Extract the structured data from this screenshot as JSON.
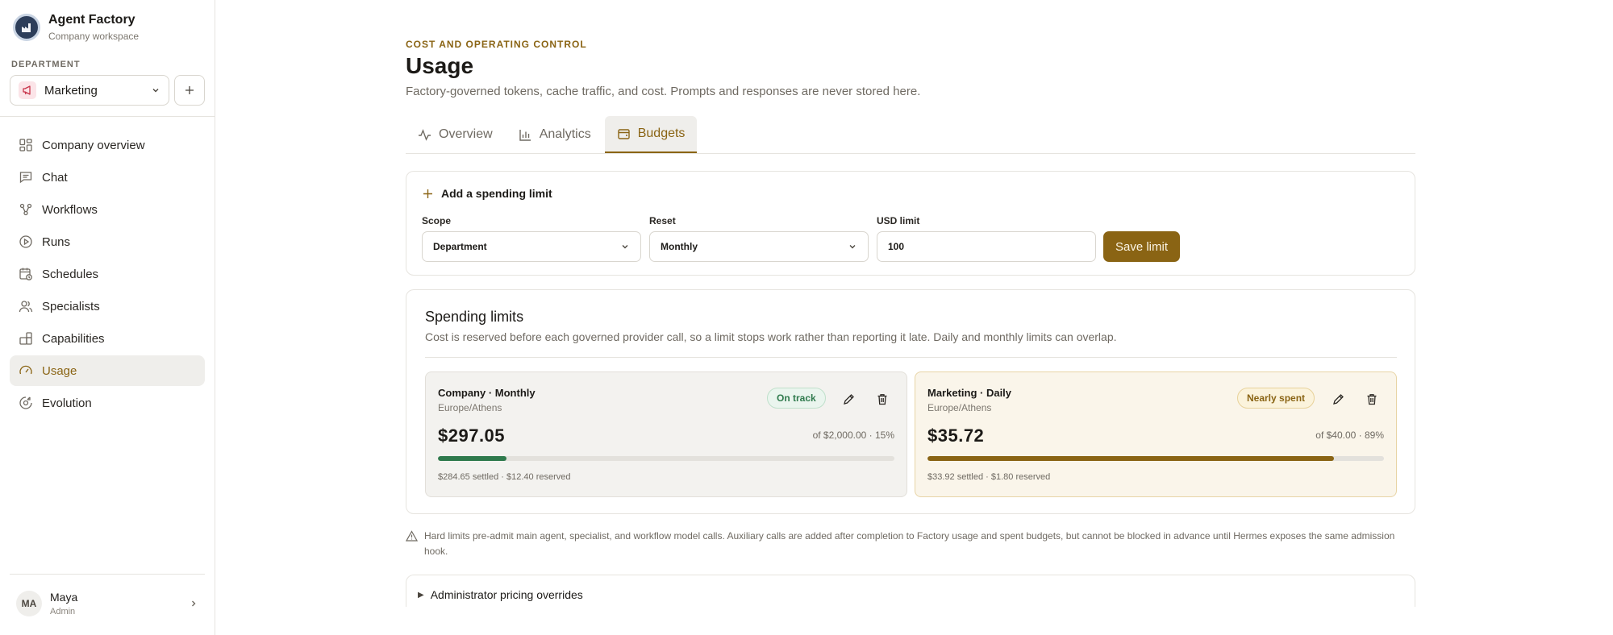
{
  "workspace": {
    "name": "Agent Factory",
    "subtitle": "Company workspace"
  },
  "department": {
    "label": "DEPARTMENT",
    "selected": "Marketing"
  },
  "nav": [
    {
      "label": "Company overview",
      "icon": "grid-icon",
      "active": false
    },
    {
      "label": "Chat",
      "icon": "chat-icon",
      "active": false
    },
    {
      "label": "Workflows",
      "icon": "workflow-icon",
      "active": false
    },
    {
      "label": "Runs",
      "icon": "play-circle-icon",
      "active": false
    },
    {
      "label": "Schedules",
      "icon": "calendar-clock-icon",
      "active": false
    },
    {
      "label": "Specialists",
      "icon": "users-icon",
      "active": false
    },
    {
      "label": "Capabilities",
      "icon": "blocks-icon",
      "active": false
    },
    {
      "label": "Usage",
      "icon": "gauge-icon",
      "active": true
    },
    {
      "label": "Evolution",
      "icon": "evolution-icon",
      "active": false
    }
  ],
  "user": {
    "initials": "MA",
    "name": "Maya",
    "role": "Admin"
  },
  "page": {
    "eyebrow": "COST AND OPERATING CONTROL",
    "title": "Usage",
    "subtitle": "Factory-governed tokens, cache traffic, and cost. Prompts and responses are never stored here."
  },
  "tabs": [
    {
      "label": "Overview",
      "icon": "activity-icon",
      "active": false
    },
    {
      "label": "Analytics",
      "icon": "bar-chart-icon",
      "active": false
    },
    {
      "label": "Budgets",
      "icon": "wallet-icon",
      "active": true
    }
  ],
  "add_limit": {
    "heading": "Add a spending limit",
    "scope_label": "Scope",
    "scope_value": "Department",
    "reset_label": "Reset",
    "reset_value": "Monthly",
    "usd_label": "USD limit",
    "usd_value": "100",
    "save_label": "Save limit"
  },
  "limits": {
    "title": "Spending limits",
    "description": "Cost is reserved before each governed provider call, so a limit stops work rather than reporting it late. Daily and monthly limits can overlap.",
    "items": [
      {
        "name": "Company · Monthly",
        "timezone": "Europe/Athens",
        "status": "On track",
        "spent": "$297.05",
        "of_text": "of $2,000.00 · 15%",
        "fraction": 0.15,
        "detail": "$284.65 settled · $12.40 reserved",
        "color": "#2f7a4d"
      },
      {
        "name": "Marketing · Daily",
        "timezone": "Europe/Athens",
        "status": "Nearly spent",
        "spent": "$35.72",
        "of_text": "of $40.00 · 89%",
        "fraction": 0.89,
        "detail": "$33.92 settled · $1.80 reserved",
        "color": "#8a6414"
      }
    ]
  },
  "note": "Hard limits pre-admit main agent, specialist, and workflow model calls. Auxiliary calls are added after completion to Factory usage and spent budgets, but cannot be blocked in advance until Hermes exposes the same admission hook.",
  "pricing_overrides": "Administrator pricing overrides"
}
